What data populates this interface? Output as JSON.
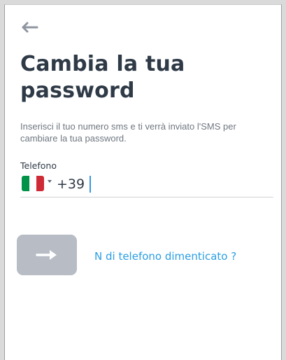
{
  "header": {
    "back_icon": "arrow-left-icon"
  },
  "title": "Cambia la tua password",
  "description": "Inserisci il tuo numero sms e ti verrà inviato l'SMS per cambiare la tua password.",
  "phone": {
    "label": "Telefono",
    "country_flag": "italy-flag-icon",
    "prefix": "+39",
    "value": "",
    "placeholder": ""
  },
  "actions": {
    "submit_icon": "arrow-right-icon",
    "forgot_phone_label": "N di telefono dimenticato ?"
  },
  "colors": {
    "title": "#2f3a47",
    "link": "#2a9ee3",
    "button_disabled": "#b7bcc5",
    "flag_green": "#009246",
    "flag_white": "#ffffff",
    "flag_red": "#ce2b37"
  }
}
